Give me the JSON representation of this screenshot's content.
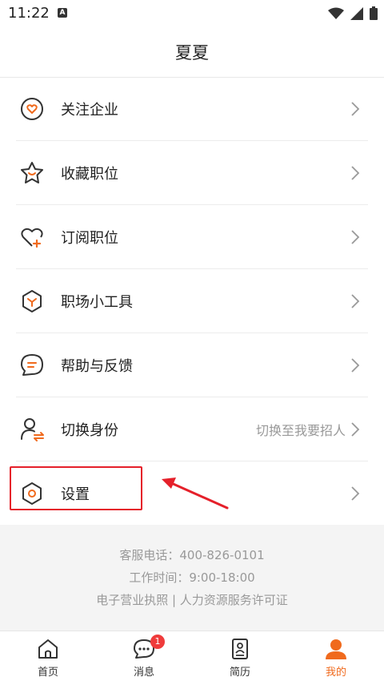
{
  "status": {
    "time": "11:22",
    "indicator": "A"
  },
  "header": {
    "title": "夏夏"
  },
  "menu": [
    {
      "label": "关注企业",
      "icon": "heart-circle-icon"
    },
    {
      "label": "收藏职位",
      "icon": "star-smile-icon"
    },
    {
      "label": "订阅职位",
      "icon": "heart-plus-icon"
    },
    {
      "label": "职场小工具",
      "icon": "hexagon-tool-icon"
    },
    {
      "label": "帮助与反馈",
      "icon": "chat-bubble-icon"
    },
    {
      "label": "切换身份",
      "icon": "user-switch-icon",
      "extra": "切换至我要招人"
    },
    {
      "label": "设置",
      "icon": "settings-hexagon-icon"
    }
  ],
  "footer": {
    "phone": "客服电话：400-826-0101",
    "hours": "工作时间：9:00-18:00",
    "links": "电子营业执照 | 人力资源服务许可证"
  },
  "tabs": [
    {
      "label": "首页",
      "icon": "home-icon"
    },
    {
      "label": "消息",
      "icon": "message-icon",
      "badge": "1"
    },
    {
      "label": "简历",
      "icon": "resume-icon"
    },
    {
      "label": "我的",
      "icon": "profile-icon",
      "active": true
    }
  ],
  "colors": {
    "accent": "#f06a1d",
    "highlight": "#e5202a",
    "badge": "#ef3b3b"
  }
}
